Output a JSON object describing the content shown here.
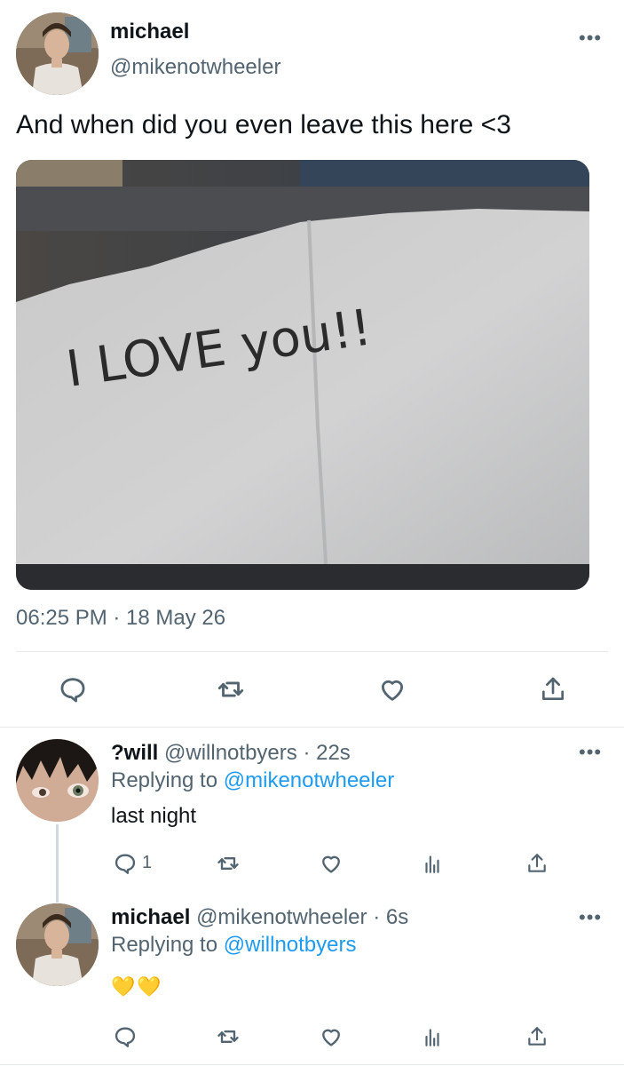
{
  "main_tweet": {
    "author_name": "michael",
    "author_handle": "@mikenotwheeler",
    "text": "And when did you even leave this here <3",
    "timestamp": "06:25 PM · 18 May 26",
    "note_text": "I LOVE you!!"
  },
  "replies": [
    {
      "author_name": "?will",
      "author_handle": "@willnotbyers",
      "time": "· 22s",
      "replying_prefix": "Replying to",
      "replying_to": "@mikenotwheeler",
      "text": "last night",
      "reply_count": "1"
    },
    {
      "author_name": "michael",
      "author_handle": "@mikenotwheeler",
      "time": "· 6s",
      "replying_prefix": "Replying to",
      "replying_to": "@willnotbyers",
      "text": "💛💛"
    }
  ],
  "colors": {
    "link": "#1d9bf0",
    "secondary_text": "#536471",
    "heart_emoji": "#f5c518"
  }
}
